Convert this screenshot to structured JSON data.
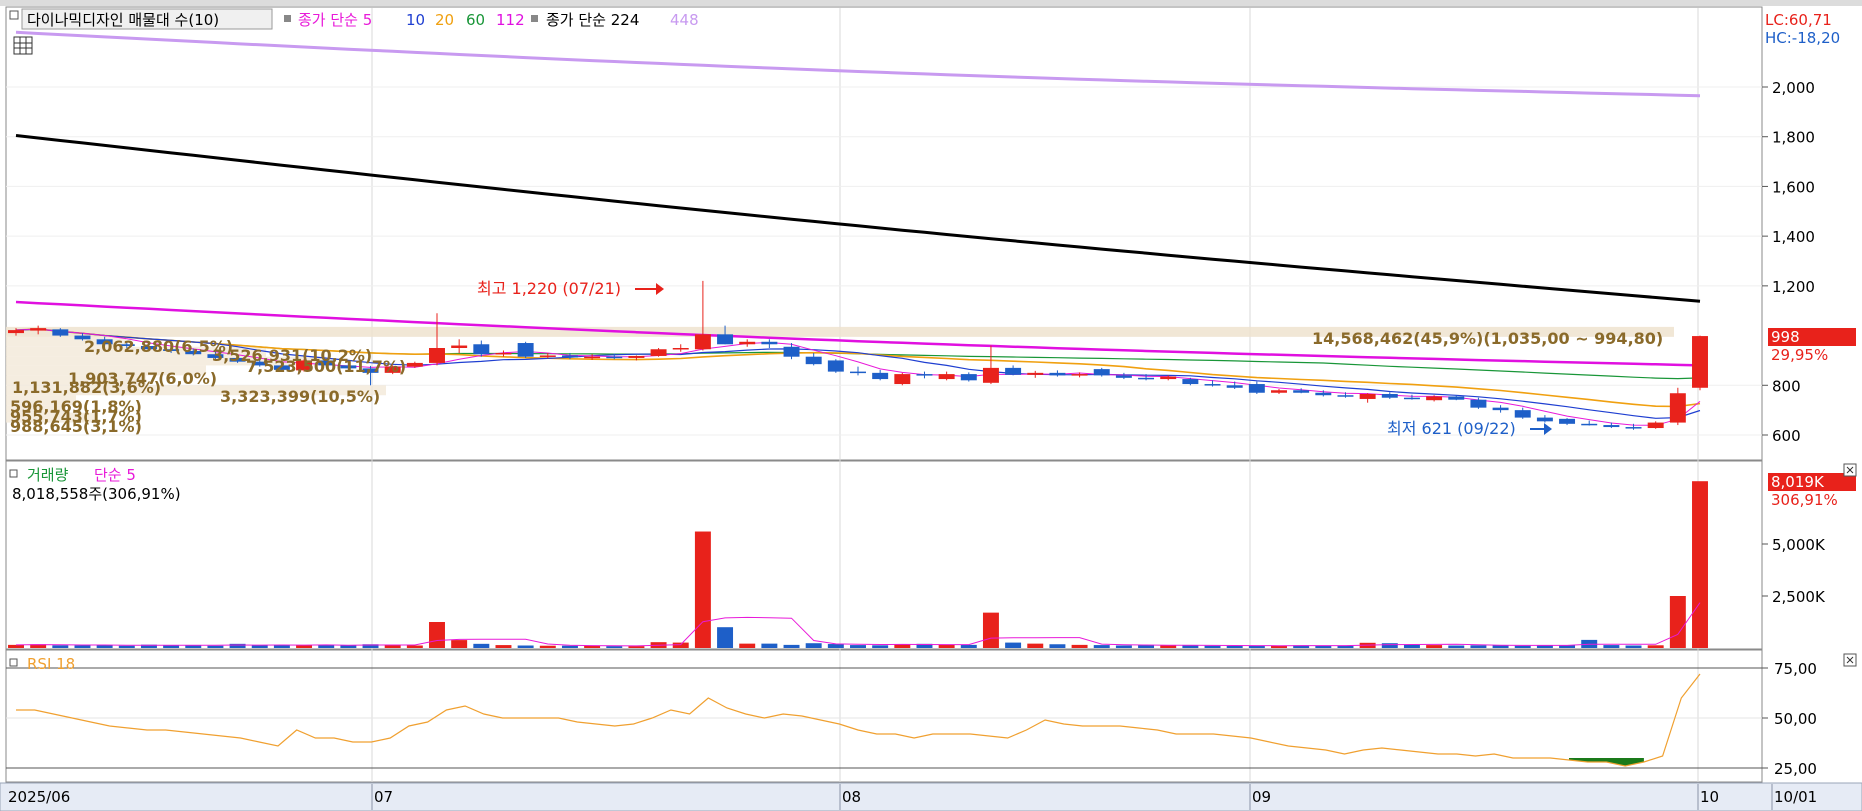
{
  "legend": {
    "stock_name": "다이나믹디자인 매물대 수(10)",
    "ma_close_label": "종가 단순 5",
    "ma_periods": [
      "10",
      "20",
      "60",
      "112"
    ],
    "ma_close2_label": "종가 단순 224",
    "ma_close2_period2": "448"
  },
  "price_axis": {
    "ticks": [
      "2,000",
      "1,800",
      "1,600",
      "1,400",
      "1,200",
      "800",
      "600"
    ],
    "lc": "LC:60,71",
    "hc": "HC:-18,20",
    "last_price": "998",
    "last_change": "29,95%"
  },
  "annotations": {
    "high": "최고 1,220 (07/21)",
    "low": "최저 621 (09/22)",
    "main_profile": "14,568,462(45,9%)(1,035,00 ~ 994,80)",
    "profiles": [
      "2,062,880(6,5%)",
      "3,526,931(10,2%)",
      "7,523,500(11,7%)",
      "1,903,747(6,0%)",
      "1,131,882(3,6%)",
      "3,323,399(10,5%)",
      "596,169(1,8%)",
      "955,743(1,7%)",
      "988,645(3,1%)"
    ]
  },
  "volume_panel": {
    "label": "거래량",
    "ma_label": "단순 5",
    "info": "8,018,558주(306,91%)",
    "ticks": [
      "5,000K",
      "2,500K"
    ],
    "last_volume": "8,019K",
    "last_ratio": "306,91%"
  },
  "rsi_panel": {
    "label": "RSI 18",
    "ticks": [
      "75,00",
      "50,00",
      "25,00"
    ]
  },
  "date_axis": {
    "labels": [
      "2025/06",
      "07",
      "08",
      "09",
      "10",
      "10/01"
    ]
  },
  "colors": {
    "up": "#e8221b",
    "down": "#1e5fc8",
    "ma5": "#e81ad9",
    "ma10": "#1f3fd1",
    "ma20": "#f0a010",
    "ma60": "#199638",
    "ma112": "#e010e0",
    "ma224": "#000000",
    "ma448": "#c89af0",
    "profile_text": "#8a6a2a",
    "rsi": "#f0a030"
  },
  "chart_data": {
    "type": "candlestick",
    "candles": [
      {
        "o": 1010,
        "h": 1030,
        "l": 1000,
        "c": 1022
      },
      {
        "o": 1020,
        "h": 1040,
        "l": 1005,
        "c": 1030
      },
      {
        "o": 1025,
        "h": 1030,
        "l": 995,
        "c": 1000
      },
      {
        "o": 1000,
        "h": 1010,
        "l": 980,
        "c": 985
      },
      {
        "o": 985,
        "h": 995,
        "l": 960,
        "c": 965
      },
      {
        "o": 965,
        "h": 975,
        "l": 950,
        "c": 958
      },
      {
        "o": 958,
        "h": 965,
        "l": 940,
        "c": 945
      },
      {
        "o": 945,
        "h": 955,
        "l": 930,
        "c": 938
      },
      {
        "o": 938,
        "h": 948,
        "l": 920,
        "c": 925
      },
      {
        "o": 925,
        "h": 935,
        "l": 905,
        "c": 910
      },
      {
        "o": 910,
        "h": 918,
        "l": 890,
        "c": 895
      },
      {
        "o": 895,
        "h": 902,
        "l": 875,
        "c": 880
      },
      {
        "o": 880,
        "h": 888,
        "l": 860,
        "c": 862
      },
      {
        "o": 860,
        "h": 905,
        "l": 855,
        "c": 900
      },
      {
        "o": 900,
        "h": 905,
        "l": 875,
        "c": 880
      },
      {
        "o": 880,
        "h": 890,
        "l": 860,
        "c": 868
      },
      {
        "o": 868,
        "h": 878,
        "l": 800,
        "c": 850
      },
      {
        "o": 850,
        "h": 880,
        "l": 845,
        "c": 875
      },
      {
        "o": 875,
        "h": 895,
        "l": 870,
        "c": 890
      },
      {
        "o": 890,
        "h": 1090,
        "l": 880,
        "c": 950
      },
      {
        "o": 950,
        "h": 985,
        "l": 930,
        "c": 960
      },
      {
        "o": 965,
        "h": 980,
        "l": 915,
        "c": 925
      },
      {
        "o": 925,
        "h": 940,
        "l": 915,
        "c": 930
      },
      {
        "o": 970,
        "h": 975,
        "l": 910,
        "c": 915
      },
      {
        "o": 915,
        "h": 930,
        "l": 908,
        "c": 920
      },
      {
        "o": 920,
        "h": 930,
        "l": 905,
        "c": 912
      },
      {
        "o": 912,
        "h": 925,
        "l": 902,
        "c": 915
      },
      {
        "o": 915,
        "h": 928,
        "l": 905,
        "c": 910
      },
      {
        "o": 910,
        "h": 920,
        "l": 900,
        "c": 918
      },
      {
        "o": 918,
        "h": 950,
        "l": 915,
        "c": 945
      },
      {
        "o": 945,
        "h": 965,
        "l": 935,
        "c": 950
      },
      {
        "o": 945,
        "h": 1220,
        "l": 940,
        "c": 1005
      },
      {
        "o": 1005,
        "h": 1040,
        "l": 965,
        "c": 965
      },
      {
        "o": 965,
        "h": 985,
        "l": 955,
        "c": 975
      },
      {
        "o": 975,
        "h": 985,
        "l": 950,
        "c": 965
      },
      {
        "o": 955,
        "h": 970,
        "l": 905,
        "c": 915
      },
      {
        "o": 915,
        "h": 930,
        "l": 880,
        "c": 885
      },
      {
        "o": 900,
        "h": 905,
        "l": 850,
        "c": 855
      },
      {
        "o": 855,
        "h": 875,
        "l": 840,
        "c": 850
      },
      {
        "o": 850,
        "h": 862,
        "l": 820,
        "c": 825
      },
      {
        "o": 805,
        "h": 850,
        "l": 800,
        "c": 845
      },
      {
        "o": 845,
        "h": 855,
        "l": 828,
        "c": 840
      },
      {
        "o": 825,
        "h": 855,
        "l": 820,
        "c": 845
      },
      {
        "o": 845,
        "h": 852,
        "l": 815,
        "c": 820
      },
      {
        "o": 810,
        "h": 960,
        "l": 805,
        "c": 870
      },
      {
        "o": 870,
        "h": 880,
        "l": 840,
        "c": 842
      },
      {
        "o": 842,
        "h": 858,
        "l": 830,
        "c": 850
      },
      {
        "o": 850,
        "h": 860,
        "l": 835,
        "c": 840
      },
      {
        "o": 840,
        "h": 852,
        "l": 832,
        "c": 845
      },
      {
        "o": 865,
        "h": 870,
        "l": 835,
        "c": 840
      },
      {
        "o": 840,
        "h": 850,
        "l": 825,
        "c": 830
      },
      {
        "o": 830,
        "h": 845,
        "l": 820,
        "c": 825
      },
      {
        "o": 825,
        "h": 840,
        "l": 820,
        "c": 835
      },
      {
        "o": 825,
        "h": 830,
        "l": 800,
        "c": 805
      },
      {
        "o": 805,
        "h": 820,
        "l": 795,
        "c": 800
      },
      {
        "o": 800,
        "h": 815,
        "l": 785,
        "c": 790
      },
      {
        "o": 805,
        "h": 815,
        "l": 765,
        "c": 770
      },
      {
        "o": 770,
        "h": 785,
        "l": 765,
        "c": 780
      },
      {
        "o": 780,
        "h": 788,
        "l": 768,
        "c": 770
      },
      {
        "o": 770,
        "h": 780,
        "l": 755,
        "c": 760
      },
      {
        "o": 760,
        "h": 772,
        "l": 750,
        "c": 758
      },
      {
        "o": 745,
        "h": 768,
        "l": 730,
        "c": 765
      },
      {
        "o": 765,
        "h": 772,
        "l": 745,
        "c": 750
      },
      {
        "o": 750,
        "h": 762,
        "l": 742,
        "c": 748
      },
      {
        "o": 740,
        "h": 760,
        "l": 735,
        "c": 755
      },
      {
        "o": 755,
        "h": 760,
        "l": 740,
        "c": 742
      },
      {
        "o": 742,
        "h": 750,
        "l": 705,
        "c": 710
      },
      {
        "o": 710,
        "h": 720,
        "l": 690,
        "c": 700
      },
      {
        "o": 700,
        "h": 710,
        "l": 665,
        "c": 670
      },
      {
        "o": 670,
        "h": 680,
        "l": 650,
        "c": 655
      },
      {
        "o": 665,
        "h": 668,
        "l": 640,
        "c": 645
      },
      {
        "o": 645,
        "h": 658,
        "l": 638,
        "c": 640
      },
      {
        "o": 640,
        "h": 650,
        "l": 628,
        "c": 632
      },
      {
        "o": 632,
        "h": 645,
        "l": 621,
        "c": 628
      },
      {
        "o": 628,
        "h": 655,
        "l": 625,
        "c": 650
      },
      {
        "o": 650,
        "h": 790,
        "l": 640,
        "c": 768
      },
      {
        "o": 790,
        "h": 1000,
        "l": 780,
        "c": 998
      }
    ],
    "volume_k": [
      150,
      180,
      130,
      120,
      140,
      110,
      160,
      120,
      140,
      110,
      200,
      120,
      140,
      130,
      150,
      120,
      180,
      140,
      120,
      1250,
      380,
      200,
      140,
      120,
      110,
      110,
      100,
      90,
      90,
      280,
      260,
      5600,
      1000,
      210,
      210,
      150,
      230,
      190,
      140,
      130,
      180,
      200,
      160,
      150,
      1700,
      260,
      210,
      180,
      150,
      140,
      120,
      140,
      130,
      120,
      110,
      100,
      120,
      110,
      130,
      110,
      100,
      250,
      230,
      150,
      140,
      120,
      130,
      130,
      110,
      130,
      120,
      390,
      140,
      120,
      130,
      2500,
      8019
    ],
    "rsi": [
      54,
      54,
      52,
      50,
      48,
      46,
      45,
      44,
      44,
      43,
      42,
      41,
      40,
      38,
      36,
      44,
      40,
      40,
      38,
      38,
      40,
      46,
      48,
      54,
      56,
      52,
      50,
      50,
      50,
      50,
      48,
      47,
      46,
      47,
      50,
      54,
      52,
      60,
      55,
      52,
      50,
      52,
      51,
      49,
      47,
      44,
      42,
      42,
      40,
      42,
      42,
      42,
      41,
      40,
      44,
      49,
      47,
      46,
      46,
      46,
      45,
      44,
      42,
      42,
      42,
      41,
      40,
      38,
      36,
      35,
      34,
      32,
      34,
      35,
      34,
      33,
      32,
      32,
      31,
      32,
      30,
      30,
      30,
      29,
      28,
      28,
      26,
      28,
      31,
      60,
      72
    ],
    "price_ticks": [
      2000,
      1800,
      1600,
      1400,
      1200,
      800,
      600
    ],
    "rsi_ticks": [
      75,
      50,
      25
    ],
    "high": {
      "price": 1220,
      "date": "07/21"
    },
    "low": {
      "price": 621,
      "date": "09/22"
    }
  }
}
